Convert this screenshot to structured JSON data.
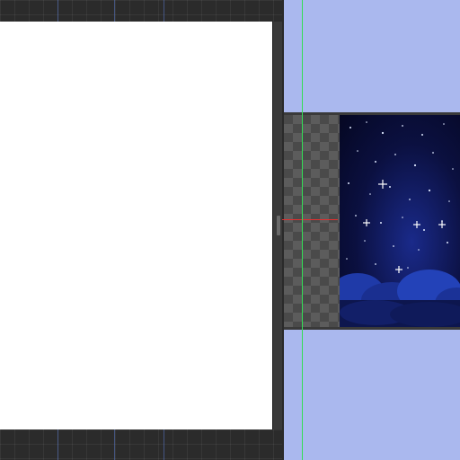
{
  "canvas": {
    "left_background": "#ffffff",
    "right_panel_color": "#aab8ee",
    "frame_color": "#2b2b2b"
  },
  "preview": {
    "image_subject": "night-sky-stars-clouds",
    "transparency_pattern": "checkerboard"
  },
  "guides": {
    "vertical_guide_color": "#33dd55",
    "horizontal_guide_color": "#e03030"
  }
}
